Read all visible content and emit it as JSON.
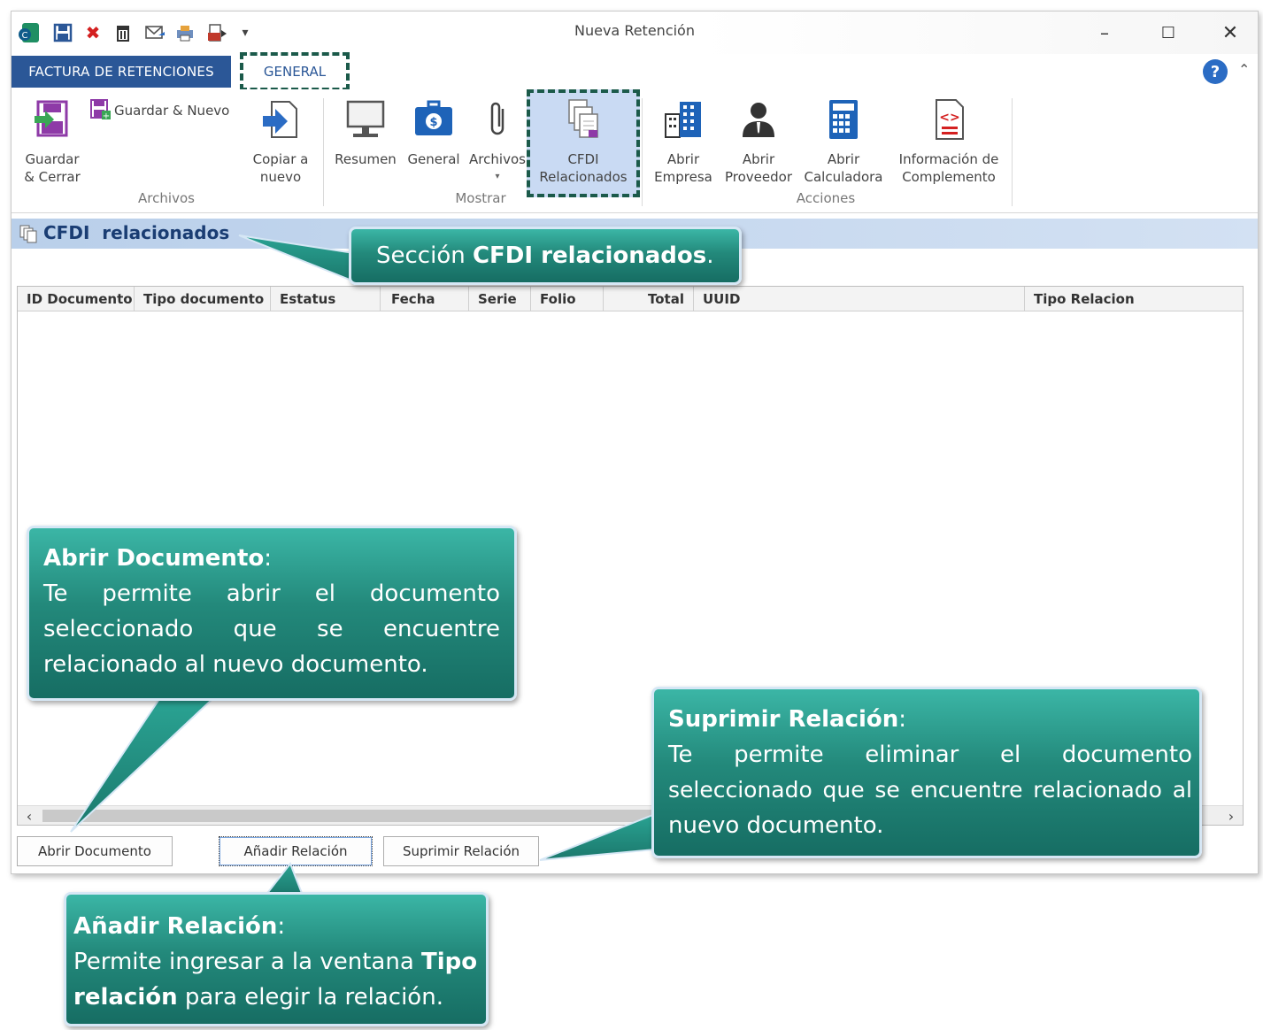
{
  "window": {
    "title": "Nueva Retención"
  },
  "tabs": {
    "file": "FACTURA DE RETENCIONES",
    "general": "GENERAL"
  },
  "ribbon": {
    "archivos": {
      "label": "Archivos",
      "guardar_cerrar": [
        "Guardar",
        "& Cerrar"
      ],
      "guardar_nuevo": "Guardar & Nuevo",
      "copiar_nuevo": [
        "Copiar a",
        "nuevo"
      ]
    },
    "mostrar": {
      "label": "Mostrar",
      "resumen": "Resumen",
      "general": "General",
      "archivos": "Archivos",
      "cfdi": [
        "CFDI",
        "Relacionados"
      ]
    },
    "acciones": {
      "label": "Acciones",
      "abrir_empresa": [
        "Abrir",
        "Empresa"
      ],
      "abrir_proveedor": [
        "Abrir",
        "Proveedor"
      ],
      "abrir_calculadora": [
        "Abrir",
        "Calculadora"
      ],
      "info_complemento": [
        "Información de",
        "Complemento"
      ]
    }
  },
  "section": {
    "title": "CFDI  relacionados"
  },
  "grid": {
    "columns": [
      "ID Documento",
      "Tipo documento",
      "Estatus",
      "Fecha",
      "Serie",
      "Folio",
      "Total",
      "UUID",
      "Tipo Relacion"
    ]
  },
  "buttons": {
    "abrir_documento": "Abrir Documento",
    "anadir_relacion": "Añadir Relación",
    "suprimir_relacion": "Suprimir Relación"
  },
  "callouts": {
    "seccion": {
      "prefix": "Sección ",
      "bold": "CFDI relacionados",
      "suffix": "."
    },
    "abrir": {
      "title": "Abrir Documento",
      "colon": ":",
      "lines": [
        "Te permite abrir el documento",
        "seleccionado que se encuentre",
        "relacionado al nuevo documento."
      ]
    },
    "suprimir": {
      "title": "Suprimir Relación",
      "colon": ":",
      "lines": [
        "Te permite eliminar el documento",
        "seleccionado que se encuentre relacionado al",
        "nuevo documento."
      ]
    },
    "anadir": {
      "title": "Añadir Relación",
      "colon": ":",
      "line1_prefix": "Permite ingresar a la ventana ",
      "line1_bold": "Tipo",
      "line2_bold": "relación",
      "line2_suffix": " para elegir la relación."
    }
  },
  "colors": {
    "callout_teal": "#23897b",
    "tab_blue": "#2b5797",
    "highlight_blue": "#c9daf3",
    "dashed_green": "#1b5a4a"
  },
  "icons": [
    "app-icon",
    "save-icon",
    "delete-icon",
    "trash-icon",
    "email-icon",
    "print-icon",
    "export-icon",
    "dropdown-icon",
    "minimize-icon",
    "maximize-icon",
    "close-icon",
    "help-icon",
    "collapse-icon",
    "save-close-icon",
    "save-new-icon",
    "copy-new-icon",
    "monitor-icon",
    "briefcase-icon",
    "paperclip-icon",
    "documents-icon",
    "building-icon",
    "person-icon",
    "calculator-icon",
    "xml-doc-icon",
    "section-icon",
    "scroll-left-icon",
    "scroll-right-icon"
  ]
}
